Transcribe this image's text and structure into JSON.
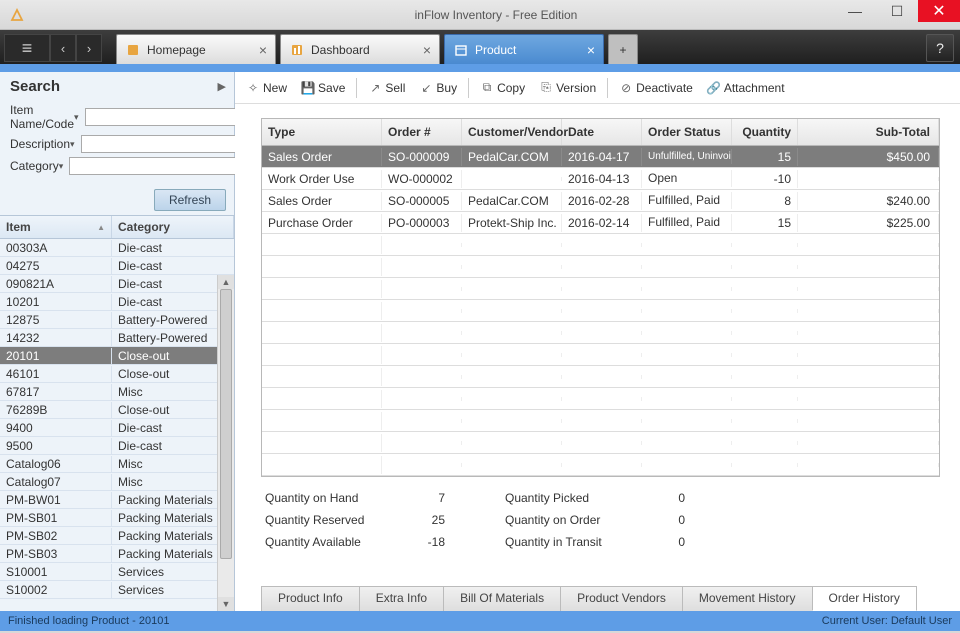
{
  "window": {
    "title": "inFlow Inventory - Free Edition"
  },
  "tabs": [
    {
      "label": "Homepage",
      "icon_color": "#e8a540"
    },
    {
      "label": "Dashboard",
      "icon_color": "#e8a540"
    },
    {
      "label": "Product",
      "active": true,
      "icon_color": "#ffffff"
    }
  ],
  "sidebar": {
    "title": "Search",
    "fields": {
      "name_label": "Item Name/Code",
      "desc_label": "Description",
      "cat_label": "Category"
    },
    "refresh": "Refresh",
    "cols": {
      "item": "Item",
      "category": "Category"
    },
    "items": [
      {
        "code": "00303A",
        "cat": "Die-cast"
      },
      {
        "code": "04275",
        "cat": "Die-cast"
      },
      {
        "code": "090821A",
        "cat": "Die-cast"
      },
      {
        "code": "10201",
        "cat": "Die-cast"
      },
      {
        "code": "12875",
        "cat": "Battery-Powered"
      },
      {
        "code": "14232",
        "cat": "Battery-Powered"
      },
      {
        "code": "20101",
        "cat": "Close-out",
        "sel": true
      },
      {
        "code": "46101",
        "cat": "Close-out"
      },
      {
        "code": "67817",
        "cat": "Misc"
      },
      {
        "code": "76289B",
        "cat": "Close-out"
      },
      {
        "code": "9400",
        "cat": "Die-cast"
      },
      {
        "code": "9500",
        "cat": "Die-cast"
      },
      {
        "code": "Catalog06",
        "cat": "Misc"
      },
      {
        "code": "Catalog07",
        "cat": "Misc"
      },
      {
        "code": "PM-BW01",
        "cat": "Packing Materials"
      },
      {
        "code": "PM-SB01",
        "cat": "Packing Materials"
      },
      {
        "code": "PM-SB02",
        "cat": "Packing Materials"
      },
      {
        "code": "PM-SB03",
        "cat": "Packing Materials"
      },
      {
        "code": "S10001",
        "cat": "Services"
      },
      {
        "code": "S10002",
        "cat": "Services"
      }
    ]
  },
  "toolbar": {
    "new": "New",
    "save": "Save",
    "sell": "Sell",
    "buy": "Buy",
    "copy": "Copy",
    "version": "Version",
    "deactivate": "Deactivate",
    "attachment": "Attachment"
  },
  "grid": {
    "cols": {
      "type": "Type",
      "order": "Order #",
      "cust": "Customer/Vendor",
      "date": "Date",
      "status": "Order Status",
      "qty": "Quantity",
      "sub": "Sub-Total"
    },
    "rows": [
      {
        "type": "Sales Order",
        "order": "SO-000009",
        "cust": "PedalCar.COM",
        "date": "2016-04-17",
        "status": "Unfulfilled, Uninvoiced",
        "qty": "15",
        "sub": "$450.00",
        "sel": true
      },
      {
        "type": "Work Order Use",
        "order": "WO-000002",
        "cust": "",
        "date": "2016-04-13",
        "status": "Open",
        "qty": "-10",
        "sub": ""
      },
      {
        "type": "Sales Order",
        "order": "SO-000005",
        "cust": "PedalCar.COM",
        "date": "2016-02-28",
        "status": "Fulfilled, Paid",
        "qty": "8",
        "sub": "$240.00"
      },
      {
        "type": "Purchase Order",
        "order": "PO-000003",
        "cust": "Protekt-Ship Inc.",
        "date": "2016-02-14",
        "status": "Fulfilled, Paid",
        "qty": "15",
        "sub": "$225.00"
      }
    ]
  },
  "summary": {
    "qoh_l": "Quantity on Hand",
    "qoh_v": "7",
    "qres_l": "Quantity Reserved",
    "qres_v": "25",
    "qav_l": "Quantity Available",
    "qav_v": "-18",
    "qp_l": "Quantity Picked",
    "qp_v": "0",
    "qoo_l": "Quantity on Order",
    "qoo_v": "0",
    "qit_l": "Quantity in Transit",
    "qit_v": "0"
  },
  "bottom_tabs": [
    "Product Info",
    "Extra Info",
    "Bill Of Materials",
    "Product Vendors",
    "Movement History",
    "Order History"
  ],
  "status": {
    "left": "Finished loading Product - 20101",
    "right": "Current User:  Default User"
  }
}
